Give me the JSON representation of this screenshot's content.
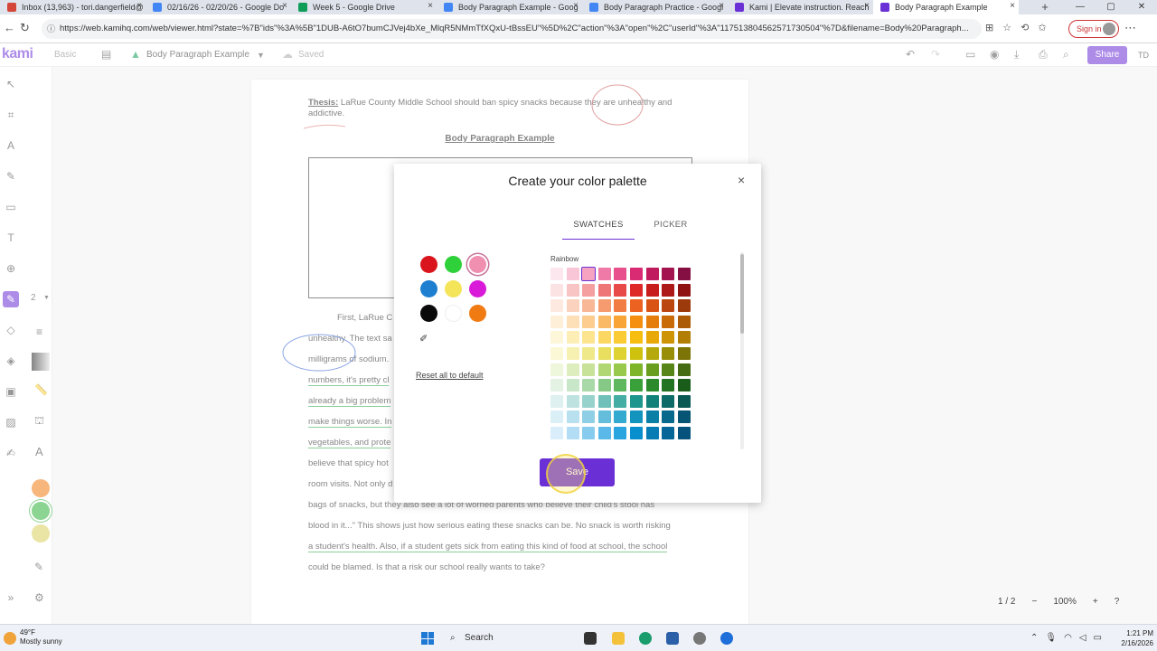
{
  "browser": {
    "tabs": [
      {
        "title": "Inbox (13,963) - tori.dangerfield@",
        "color": "#d44638"
      },
      {
        "title": "02/16/26 - 02/20/26 - Google Do",
        "color": "#4285f4"
      },
      {
        "title": "Week 5 - Google Drive",
        "color": "#0f9d58"
      },
      {
        "title": "Body Paragraph Example - Goog",
        "color": "#4285f4"
      },
      {
        "title": "Body Paragraph Practice - Googl",
        "color": "#4285f4"
      },
      {
        "title": "Kami | Elevate instruction. Reach",
        "color": "#6b2fd6"
      },
      {
        "title": "Body Paragraph Example",
        "color": "#6b2fd6"
      }
    ],
    "new_tab": "+",
    "url": "https://web.kamihq.com/web/viewer.html?state=%7B\"ids\"%3A%5B\"1DUB-A6tO7bumCJVej4bXe_MlqR5NMmTfXQxU-tBssEU\"%5D%2C\"action\"%3A\"open\"%2C\"userId\"%3A\"117513804562571730504\"%7D&filename=Body%20Paragraph...",
    "signin": "Sign in"
  },
  "kami": {
    "logo": "kami",
    "mode": "Basic",
    "doc_name": "Body Paragraph Example",
    "saved": "Saved",
    "share": "Share",
    "user_initials": "TD",
    "zoom_size": "2"
  },
  "document": {
    "thesis_label": "Thesis:",
    "thesis_text": " LaRue County Middle School should ban spicy snacks because they are unhealthy and addictive.",
    "heading": "Body Paragraph Example",
    "lines": [
      {
        "text": "First, LaRue C",
        "indent": true
      },
      {
        "text": "unhealthy. The text sa",
        "hl": false
      },
      {
        "text": "milligrams of sodium.",
        "hl": false
      },
      {
        "text": "numbers, it's pretty cl",
        "hl": true
      },
      {
        "text": "already a big problem",
        "hl": true
      },
      {
        "text": "make things worse. In",
        "hl": true
      },
      {
        "text": "vegetables, and prote",
        "hl": true
      },
      {
        "text": "believe that spicy hot",
        "hl": false
      },
      {
        "text": "room visits. Not only d",
        "hl": false
      },
      {
        "text": "bags of snacks, but they also see a lot of worried parents who believe their child's stool has",
        "hl": false
      },
      {
        "text": "blood in it...\" This shows just how serious eating these snacks can be. No snack is worth risking",
        "hl": false
      },
      {
        "text": "a student's health. Also, if a student gets sick from eating this kind of food at school, the school",
        "hl": true
      },
      {
        "text": "could be blamed. Is that a risk our school really wants to take?",
        "hl": false
      }
    ]
  },
  "modal": {
    "title": "Create your color palette",
    "close": "×",
    "tab_swatches": "SWATCHES",
    "tab_picker": "PICKER",
    "palette": [
      {
        "color": "#d9141c",
        "selected": false
      },
      {
        "color": "#2fd13a",
        "selected": false
      },
      {
        "color": "#f08fb0",
        "selected": true
      },
      {
        "color": "#1e7fd0",
        "selected": false
      },
      {
        "color": "#f3e45a",
        "selected": false
      },
      {
        "color": "#d91ad9",
        "selected": false
      },
      {
        "color": "#0a0a0a",
        "selected": false
      },
      {
        "color": "#ffffff",
        "selected": false
      },
      {
        "color": "#f07b12",
        "selected": false
      }
    ],
    "reset_label": "Reset all to default",
    "rainbow_label": "Rainbow",
    "grid_columns": [
      [
        "#fde7ee",
        "#fce3e3",
        "#fde9df",
        "#feefd9",
        "#fef6d8",
        "#fbf8d5",
        "#eef6dc",
        "#e3f2e3",
        "#def0ef",
        "#dbeff6",
        "#d9eefa"
      ],
      [
        "#f9c6d7",
        "#f9c4c4",
        "#fbd2bd",
        "#fde0b8",
        "#fdeeb6",
        "#f7f1b1",
        "#ddedbd",
        "#c8e6c8",
        "#bde2df",
        "#b8e0ee",
        "#b3ddf5"
      ],
      [
        "#f5a3c0",
        "#f4a0a0",
        "#f8b898",
        "#fccd8f",
        "#fde48e",
        "#f0e98a",
        "#c8e29a",
        "#a9d8a9",
        "#98d2cd",
        "#8fcfe5",
        "#87ccef"
      ],
      [
        "#ef7aa7",
        "#ee7676",
        "#f59b6f",
        "#fab964",
        "#fcd862",
        "#e8df5f",
        "#b1d674",
        "#86c886",
        "#6fc0b9",
        "#64bddb",
        "#5ab9e8"
      ],
      [
        "#e74f8d",
        "#e84a4a",
        "#f27d44",
        "#f8a436",
        "#fbcb33",
        "#dfd333",
        "#98c94c",
        "#5fb75f",
        "#44ada4",
        "#35aad0",
        "#2ba5e0"
      ],
      [
        "#d92b73",
        "#de2828",
        "#ec6220",
        "#f48f12",
        "#f7bd0f",
        "#cfc20f",
        "#7fb52a",
        "#3aa13a",
        "#1c978d",
        "#1294be",
        "#0a8fce"
      ],
      [
        "#c01b5f",
        "#c81d1d",
        "#d95414",
        "#e47d0b",
        "#e8a908",
        "#b5a90b",
        "#6a9e1f",
        "#2c8a2c",
        "#12817a",
        "#0b7fa6",
        "#077bb3"
      ],
      [
        "#a31350",
        "#ad1818",
        "#bc4610",
        "#c96c08",
        "#cf9306",
        "#988e08",
        "#578518",
        "#227322",
        "#0d6c67",
        "#08698d",
        "#066698"
      ],
      [
        "#850e42",
        "#8f1313",
        "#9d3a0c",
        "#ac5b06",
        "#b27e05",
        "#7c7406",
        "#456c13",
        "#1a5d1a",
        "#0a5854",
        "#065574",
        "#05527c"
      ]
    ],
    "picked_cell": [
      2,
      0
    ],
    "save_label": "Save"
  },
  "pager": {
    "page": "1 / 2",
    "zoom": "100%",
    "minus": "−",
    "plus": "+",
    "help": "?"
  },
  "taskbar": {
    "temp": "49°F",
    "condition": "Mostly sunny",
    "search": "Search",
    "time": "1:21 PM",
    "date": "2/16/2026"
  }
}
